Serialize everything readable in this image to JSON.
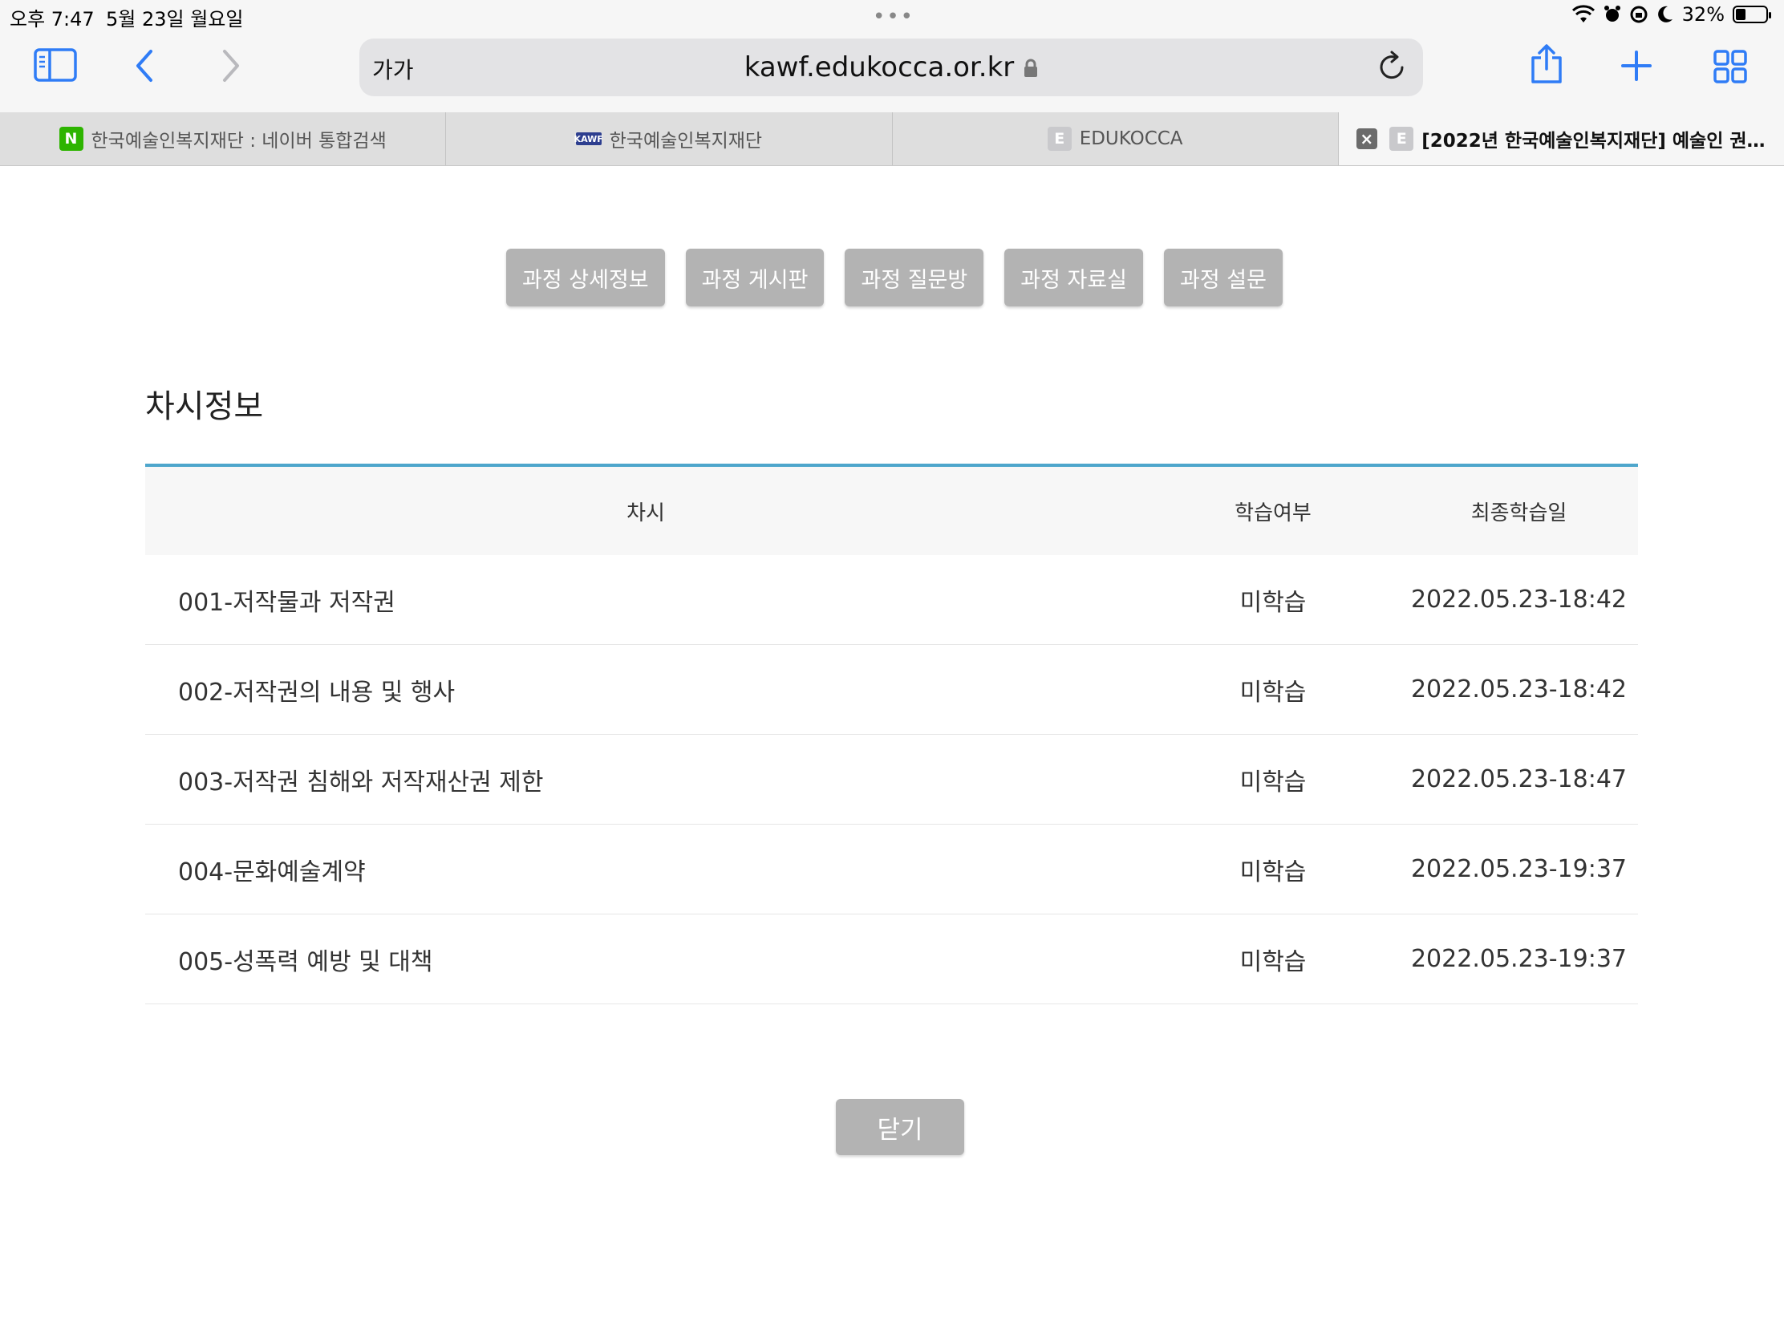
{
  "status": {
    "time": "오후 7:47",
    "date": "5월 23일 월요일",
    "battery": "32%",
    "battery_level": 0.32
  },
  "browser": {
    "text_size_label": "가가",
    "url": "kawf.edukocca.or.kr",
    "tabs": [
      {
        "label": "한국예술인복지재단 : 네이버 통합검색",
        "favicon": "N"
      },
      {
        "label": "한국예술인복지재단",
        "favicon": "KAWF"
      },
      {
        "label": "EDUKOCCA",
        "favicon": "E"
      },
      {
        "label": "[2022년 한국예술인복지재단] 예술인 권…",
        "favicon": "E"
      }
    ]
  },
  "page": {
    "nav_buttons": [
      "과정 상세정보",
      "과정 게시판",
      "과정 질문방",
      "과정 자료실",
      "과정 설문"
    ],
    "section_title": "차시정보",
    "table": {
      "headers": [
        "차시",
        "학습여부",
        "최종학습일"
      ],
      "rows": [
        {
          "title": "001-저작물과 저작권",
          "status": "미학습",
          "date": "2022.05.23-18:42"
        },
        {
          "title": "002-저작권의 내용 및 행사",
          "status": "미학습",
          "date": "2022.05.23-18:42"
        },
        {
          "title": "003-저작권 침해와 저작재산권 제한",
          "status": "미학습",
          "date": "2022.05.23-18:47"
        },
        {
          "title": "004-문화예술계약",
          "status": "미학습",
          "date": "2022.05.23-19:37"
        },
        {
          "title": "005-성폭력 예방 및 대책",
          "status": "미학습",
          "date": "2022.05.23-19:37"
        }
      ]
    },
    "close_button": "닫기"
  },
  "colors": {
    "accent_line": "#4ea6cc",
    "button_gray": "#b3b3b3",
    "safari_blue": "#2f7cf6"
  }
}
